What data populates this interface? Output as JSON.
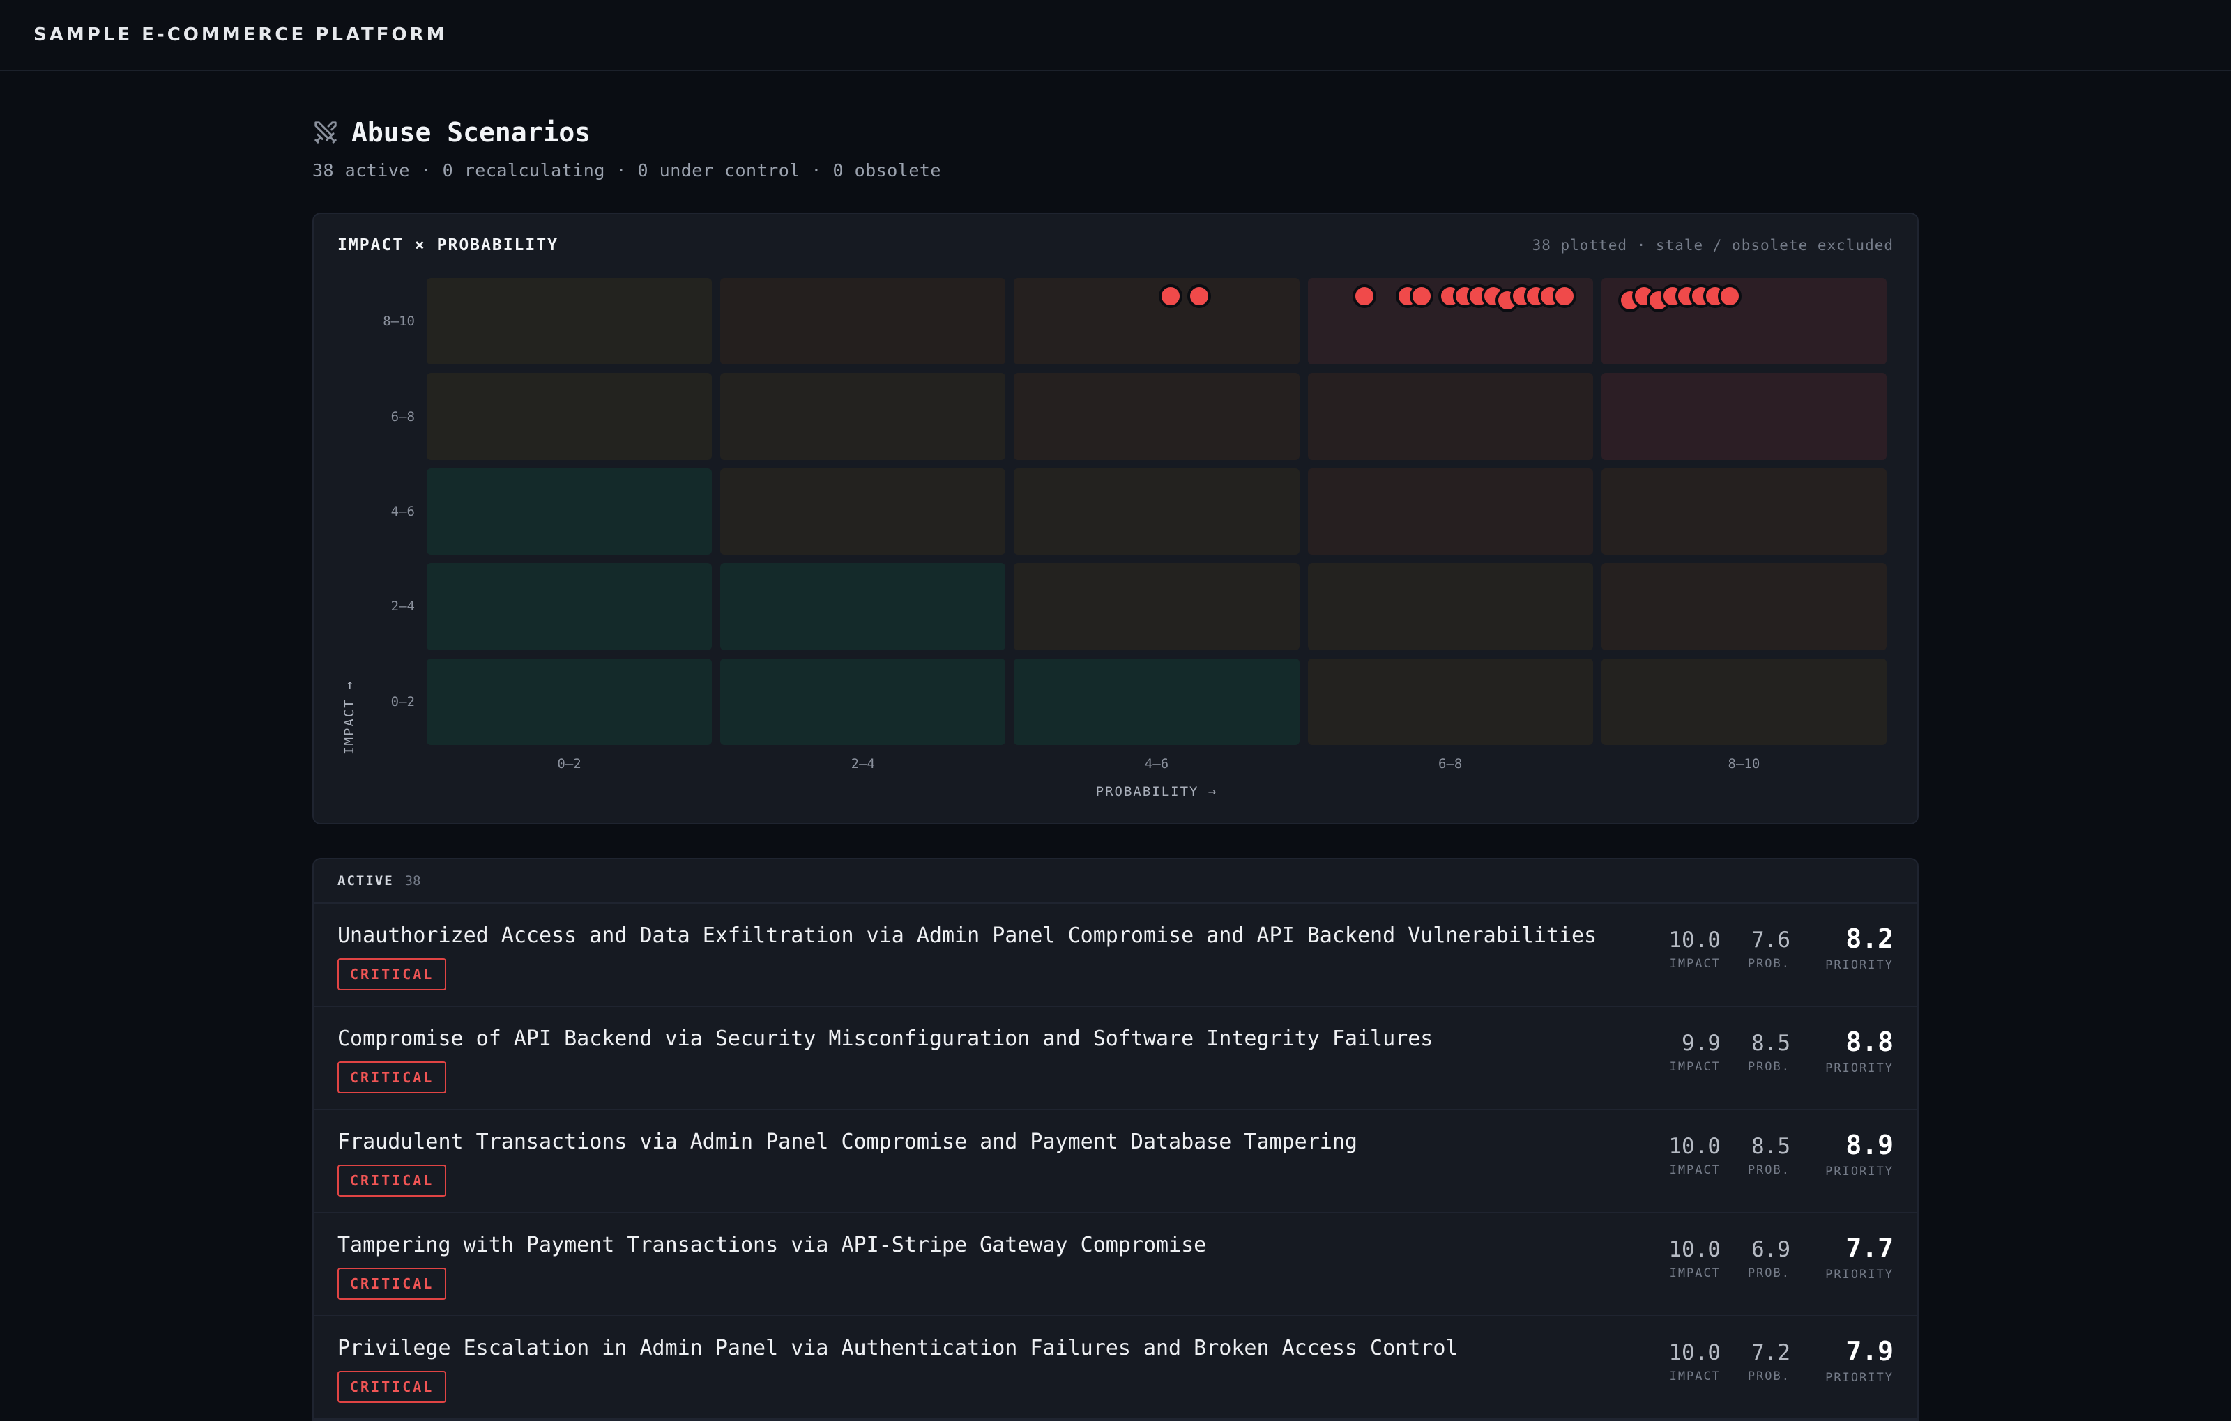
{
  "app": {
    "brand": "SAMPLE E-COMMERCE PLATFORM"
  },
  "page": {
    "title": "Abuse Scenarios",
    "title_icon": "swords-icon",
    "subtitle": "38 active · 0 recalculating · 0 under control · 0 obsolete"
  },
  "matrix": {
    "title": "IMPACT × PROBABILITY",
    "meta": "38 plotted · stale / obsolete excluded",
    "y_label": "IMPACT →",
    "x_label": "PROBABILITY →",
    "y_ticks": [
      "8–10",
      "6–8",
      "4–6",
      "2–4",
      "0–2"
    ],
    "x_ticks": [
      "0–2",
      "2–4",
      "4–6",
      "6–8",
      "8–10"
    ],
    "cell_colors": [
      [
        "#23231f",
        "#241f1e",
        "#25201f",
        "#2a1f25",
        "#2c1e25"
      ],
      [
        "#23231f",
        "#23221f",
        "#25201f",
        "#261f20",
        "#2c1e25"
      ],
      [
        "#142a2a",
        "#23221f",
        "#23221f",
        "#261f20",
        "#25201f"
      ],
      [
        "#142a2a",
        "#142a2a",
        "#23221f",
        "#23221f",
        "#25201f"
      ],
      [
        "#142a2a",
        "#142a2a",
        "#142a2a",
        "#23221f",
        "#23221f"
      ]
    ],
    "dot_color": "#f04a4a"
  },
  "chart_data": {
    "type": "scatter",
    "title": "IMPACT × PROBABILITY",
    "xlabel": "PROBABILITY →",
    "ylabel": "IMPACT →",
    "xlim": [
      0,
      10
    ],
    "ylim": [
      0,
      10
    ],
    "points": [
      {
        "x": 5.1,
        "y": 10.0
      },
      {
        "x": 5.3,
        "y": 10.0
      },
      {
        "x": 6.4,
        "y": 10.0
      },
      {
        "x": 6.7,
        "y": 10.0
      },
      {
        "x": 6.8,
        "y": 10.0
      },
      {
        "x": 7.0,
        "y": 10.0
      },
      {
        "x": 7.1,
        "y": 10.0
      },
      {
        "x": 7.2,
        "y": 10.0
      },
      {
        "x": 7.3,
        "y": 10.0
      },
      {
        "x": 7.4,
        "y": 9.9
      },
      {
        "x": 7.5,
        "y": 10.0
      },
      {
        "x": 7.6,
        "y": 10.0
      },
      {
        "x": 7.7,
        "y": 10.0
      },
      {
        "x": 7.8,
        "y": 10.0
      },
      {
        "x": 8.2,
        "y": 9.9
      },
      {
        "x": 8.3,
        "y": 10.0
      },
      {
        "x": 8.4,
        "y": 9.9
      },
      {
        "x": 8.5,
        "y": 10.0
      },
      {
        "x": 8.6,
        "y": 10.0
      },
      {
        "x": 8.7,
        "y": 10.0
      },
      {
        "x": 8.8,
        "y": 10.0
      },
      {
        "x": 8.9,
        "y": 10.0
      }
    ]
  },
  "list": {
    "header_label": "ACTIVE",
    "header_count": "38",
    "metric_labels": {
      "impact": "IMPACT",
      "prob": "PROB.",
      "priority": "PRIORITY"
    },
    "rows": [
      {
        "title": "Unauthorized Access and Data Exfiltration via Admin Panel Compromise and API Backend Vulnerabilities",
        "severity": "CRITICAL",
        "impact": "10.0",
        "prob": "7.6",
        "priority": "8.2"
      },
      {
        "title": "Compromise of API Backend via Security Misconfiguration and Software Integrity Failures",
        "severity": "CRITICAL",
        "impact": "9.9",
        "prob": "8.5",
        "priority": "8.8"
      },
      {
        "title": "Fraudulent Transactions via Admin Panel Compromise and Payment Database Tampering",
        "severity": "CRITICAL",
        "impact": "10.0",
        "prob": "8.5",
        "priority": "8.9"
      },
      {
        "title": "Tampering with Payment Transactions via API-Stripe Gateway Compromise",
        "severity": "CRITICAL",
        "impact": "10.0",
        "prob": "6.9",
        "priority": "7.7"
      },
      {
        "title": "Privilege Escalation in Admin Panel via Authentication Failures and Broken Access Control",
        "severity": "CRITICAL",
        "impact": "10.0",
        "prob": "7.2",
        "priority": "7.9"
      }
    ]
  }
}
